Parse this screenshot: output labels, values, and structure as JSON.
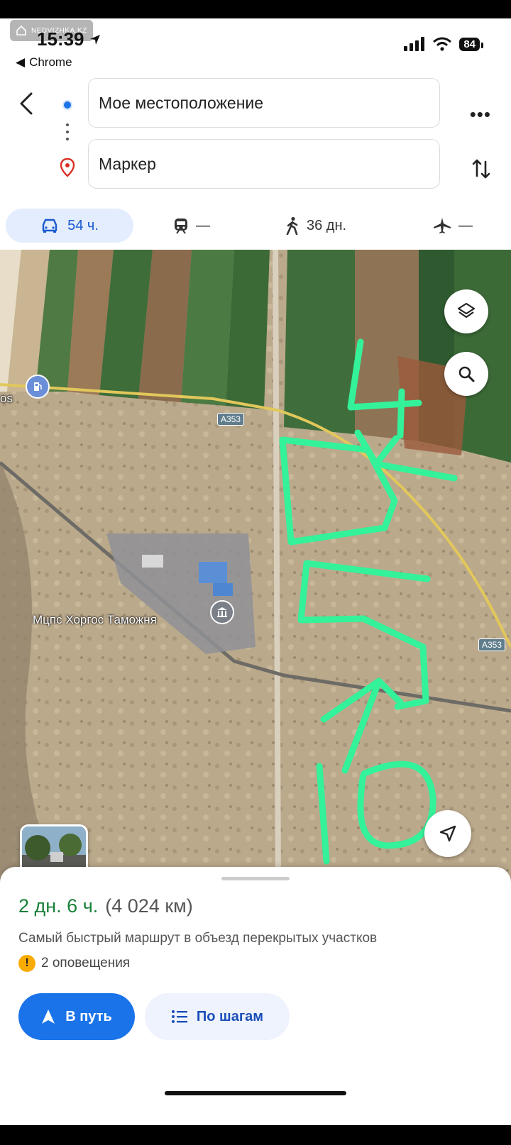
{
  "status_bar": {
    "watermark": "NEDVIZHKA.KZ",
    "time": "15:39",
    "back_app": "Chrome",
    "battery": "84"
  },
  "directions": {
    "origin": "Мое местоположение",
    "destination": "Маркер"
  },
  "travel_modes": {
    "car": "54 ч.",
    "transit": "—",
    "walk": "36 дн.",
    "flight": "—"
  },
  "map": {
    "road_label_1": "A353",
    "road_label_2": "A353",
    "poi_left": "os",
    "poi_customs": "Мцпс Хоргос Таможня",
    "drawing_colors": {
      "annotation": "#34f29a"
    },
    "annotation_numbers": [
      "4",
      "5",
      "10"
    ]
  },
  "route_sheet": {
    "eta": "2 дн. 6 ч.",
    "distance": "(4 024 км)",
    "description": "Самый быстрый маршрут в объезд перекрытых участков",
    "alert_text": "2 оповещения",
    "start_label": "В путь",
    "steps_label": "По шагам"
  },
  "colors": {
    "accent": "#1a73e8",
    "eta_green": "#188038",
    "alert": "#f9ab00"
  }
}
